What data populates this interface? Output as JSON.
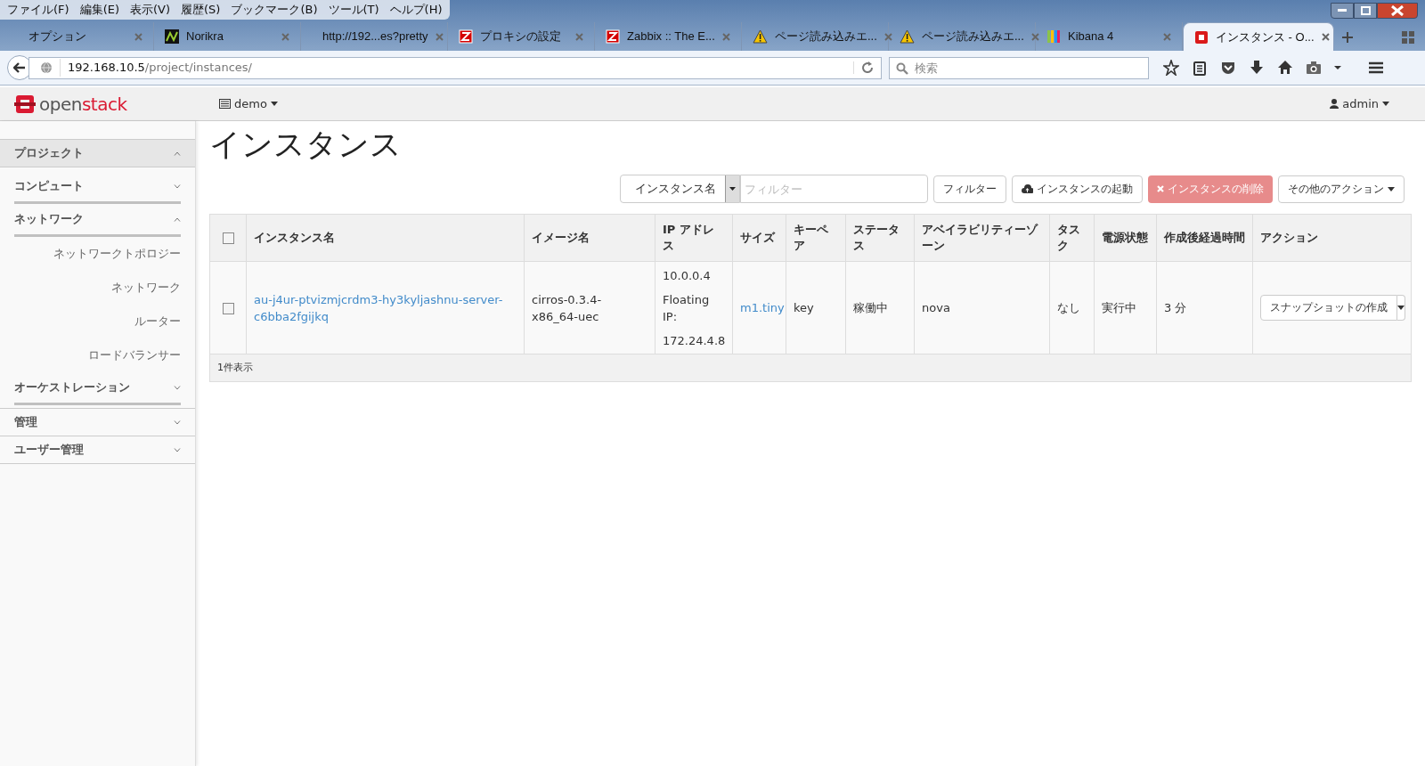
{
  "menu_bar": [
    "ファイル(F)",
    "編集(E)",
    "表示(V)",
    "履歴(S)",
    "ブックマーク(B)",
    "ツール(T)",
    "ヘルプ(H)"
  ],
  "tabs": [
    {
      "label": "オプション",
      "kind": "plain",
      "selected": false
    },
    {
      "label": "Norikra",
      "kind": "chart",
      "selected": false
    },
    {
      "label": "http://192...es?pretty",
      "kind": "plain",
      "selected": false
    },
    {
      "label": "プロキシの設定",
      "kind": "letter",
      "selected": false
    },
    {
      "label": "Zabbix :: The E...",
      "kind": "letter",
      "selected": false
    },
    {
      "label": "ページ読み込みエ...",
      "kind": "warning",
      "selected": false
    },
    {
      "label": "ページ読み込みエ...",
      "kind": "warning",
      "selected": false
    },
    {
      "label": "Kibana 4",
      "kind": "bars",
      "selected": false
    },
    {
      "label": "インスタンス - O...",
      "kind": "square",
      "selected": true
    }
  ],
  "address": {
    "host": "192.168.10.5",
    "path": "/project/instances/"
  },
  "search": {
    "placeholder": "検索"
  },
  "header": {
    "logo_prefix": "open",
    "logo_suffix": "stack",
    "project": "demo",
    "user": "admin"
  },
  "sidebar": [
    {
      "label": "プロジェクト",
      "expanded": true,
      "children": [
        {
          "label": "コンピュート",
          "expanded": false
        },
        {
          "label": "ネットワーク",
          "expanded": true,
          "children": [
            {
              "label": "ネットワークトポロジー"
            },
            {
              "label": "ネットワーク"
            },
            {
              "label": "ルーター"
            },
            {
              "label": "ロードバランサー"
            }
          ]
        },
        {
          "label": "オーケストレーション",
          "expanded": false
        }
      ]
    },
    {
      "label": "管理",
      "expanded": false
    },
    {
      "label": "ユーザー管理",
      "expanded": false
    }
  ],
  "page_title": "インスタンス",
  "toolbar": {
    "filter_select": "インスタンス名",
    "filter_placeholder": "フィルター",
    "filter_button": "フィルター",
    "launch_button": "インスタンスの起動",
    "delete_button": {
      "label": "インスタンスの削除",
      "disabled": true
    },
    "more_button": "その他のアクション"
  },
  "table": {
    "header_checked": false,
    "columns": [
      "インスタンス名",
      "イメージ名",
      "IP アドレス",
      "サイズ",
      "キーペア",
      "ステータス",
      "アベイラビリティーゾーン",
      "タスク",
      "電源状態",
      "作成後経過時間",
      "アクション"
    ],
    "rows": [
      {
        "checked": false,
        "name": "au-j4ur-ptvizmjcrdm3-hy3kyljashnu-server-c6bba2fgijkq",
        "image": "cirros-0.3.4-x86_64-uec",
        "ip": [
          "10.0.0.4",
          "Floating IP:",
          "172.24.4.8"
        ],
        "size": "m1.tiny",
        "keypair": "key",
        "status": "稼働中",
        "zone": "nova",
        "task": "なし",
        "power": "実行中",
        "age": "3 分",
        "action": "スナップショットの作成"
      }
    ],
    "footer": "1件表示"
  }
}
